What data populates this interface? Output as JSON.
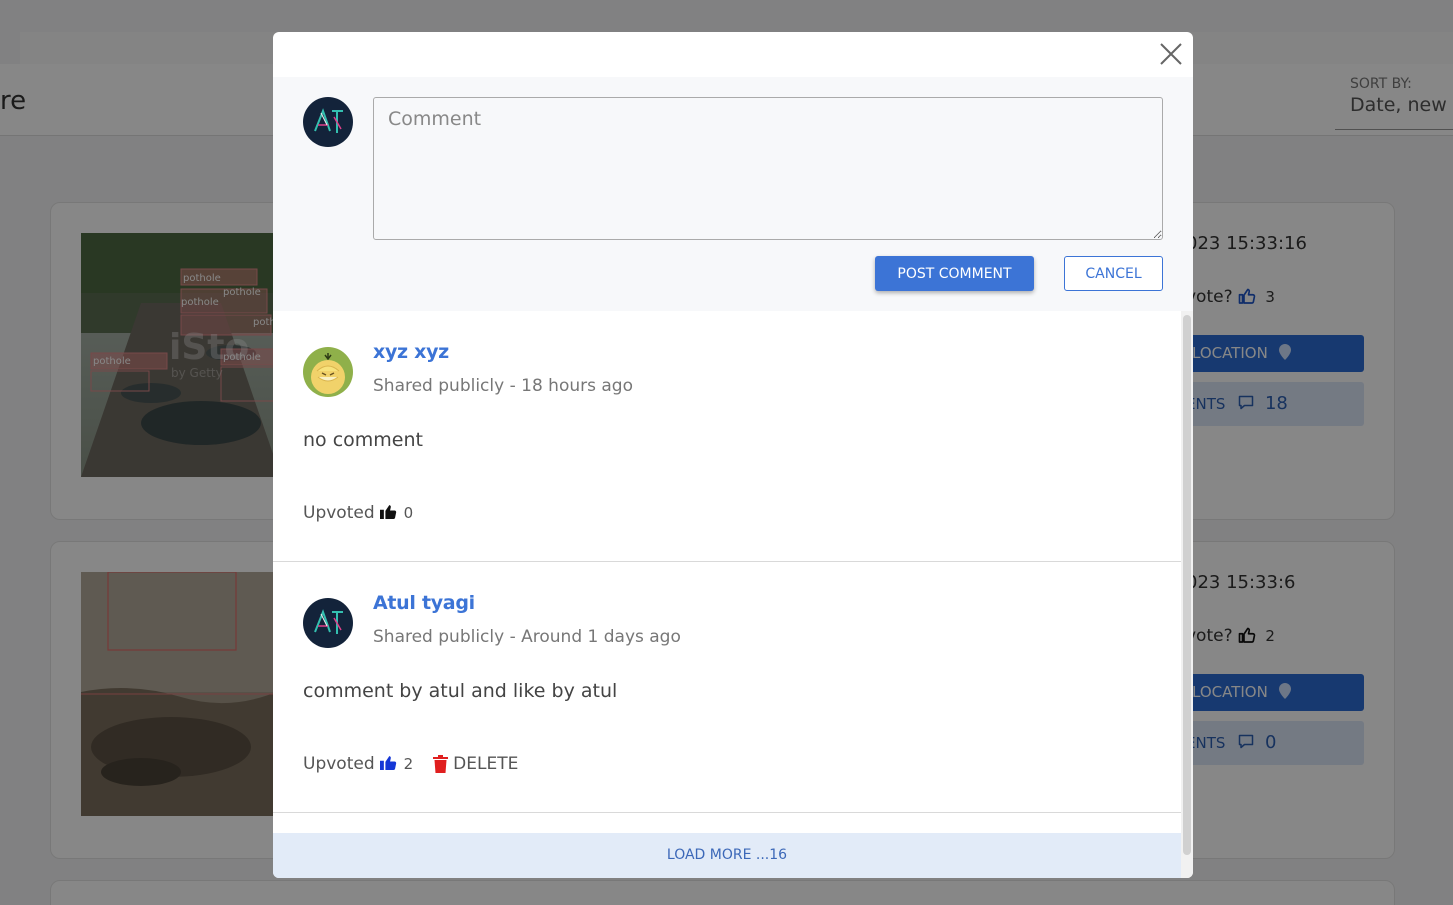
{
  "background": {
    "title_fragment": "re",
    "sort": {
      "label": "SORT BY:",
      "value": "Date, new t"
    },
    "cards": [
      {
        "date": "023 15:33:16",
        "upvote_label": "vote?",
        "upvote_count": "3",
        "location_label": "LOCATION",
        "comments_label": "ENTS",
        "comments_count": "18",
        "image_labels": [
          "pothole",
          "pothole",
          "pothole",
          "pothole",
          "pothole",
          "pothole"
        ],
        "watermark": "iSto",
        "watermark_sub": "by Getty"
      },
      {
        "date": "023 15:33:6",
        "upvote_label": "vote?",
        "upvote_count": "2",
        "location_label": "LOCATION",
        "comments_label": "ENTS",
        "comments_count": "0",
        "image_labels": []
      }
    ]
  },
  "modal": {
    "composer": {
      "placeholder": "Comment",
      "post_label": "POST COMMENT",
      "cancel_label": "CANCEL"
    },
    "comments": [
      {
        "author": "xyz xyz",
        "meta": "Shared publicly - 18 hours ago",
        "text": "no comment",
        "upvote_label": "Upvoted",
        "upvote_count": "0",
        "delete_label": ""
      },
      {
        "author": "Atul tyagi",
        "meta": "Shared publicly - Around 1 days ago",
        "text": "comment by atul and like by atul",
        "upvote_label": "Upvoted",
        "upvote_count": "2",
        "delete_label": "DELETE"
      }
    ],
    "load_more_label": "LOAD MORE ...16"
  },
  "colors": {
    "accent": "#3c74d6",
    "delete": "#e01f1f",
    "load_more_bg": "#e2ebf8"
  }
}
